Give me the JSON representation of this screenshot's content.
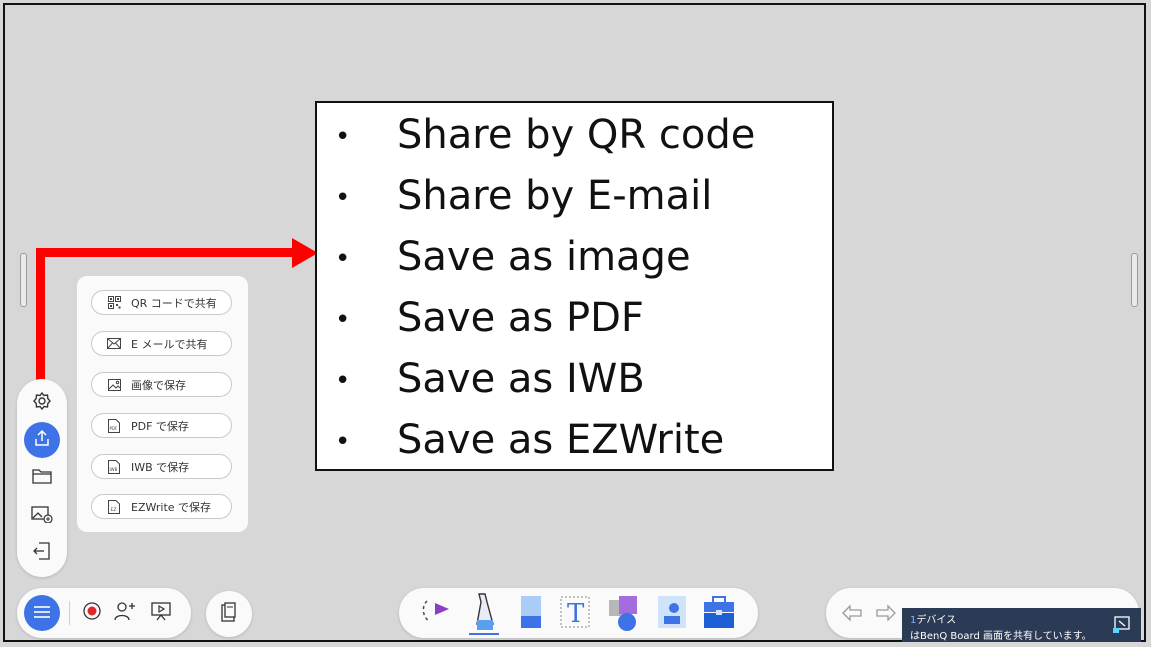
{
  "share_menu": {
    "items": [
      {
        "label": "QR コードで共有",
        "icon": "qr-code-icon"
      },
      {
        "label": "E メールで共有",
        "icon": "mail-icon"
      },
      {
        "label": "画像で保存",
        "icon": "image-icon"
      },
      {
        "label": "PDF で保存",
        "icon": "pdf-file-icon"
      },
      {
        "label": "IWB で保存",
        "icon": "iwb-file-icon"
      },
      {
        "label": "EZWrite で保存",
        "icon": "ezwrite-file-icon"
      }
    ]
  },
  "callout": {
    "bullet": "•",
    "items": [
      "Share by QR code",
      "Share by E-mail",
      "Save as image",
      "Save as PDF",
      "Save as IWB",
      "Save as EZWrite"
    ]
  },
  "left_toolbar": {
    "icons": [
      "settings-gear-icon",
      "share-upload-icon",
      "folder-icon",
      "add-background-icon",
      "exit-icon"
    ],
    "active": "share-upload-icon"
  },
  "bottom_toolbar": {
    "left_icons": [
      "menu-icon",
      "record-icon",
      "invite-user-icon",
      "present-icon",
      "clipboard-icon"
    ],
    "center_tools": [
      "lasso-select-icon",
      "pen-icon",
      "eraser-icon",
      "text-icon",
      "shapes-icon",
      "image-insert-icon",
      "toolbox-icon"
    ],
    "right_icons": [
      "undo-icon",
      "redo-icon"
    ]
  },
  "toast": {
    "count": "1",
    "line1": "デバイス",
    "line2": "はBenQ Board 画面を共有しています。",
    "icon": "screen-share-icon"
  },
  "colors": {
    "accent": "#3d73e6",
    "arrow": "#ff0000",
    "background": "#d7d7d7",
    "toast": "#2b3b55"
  }
}
